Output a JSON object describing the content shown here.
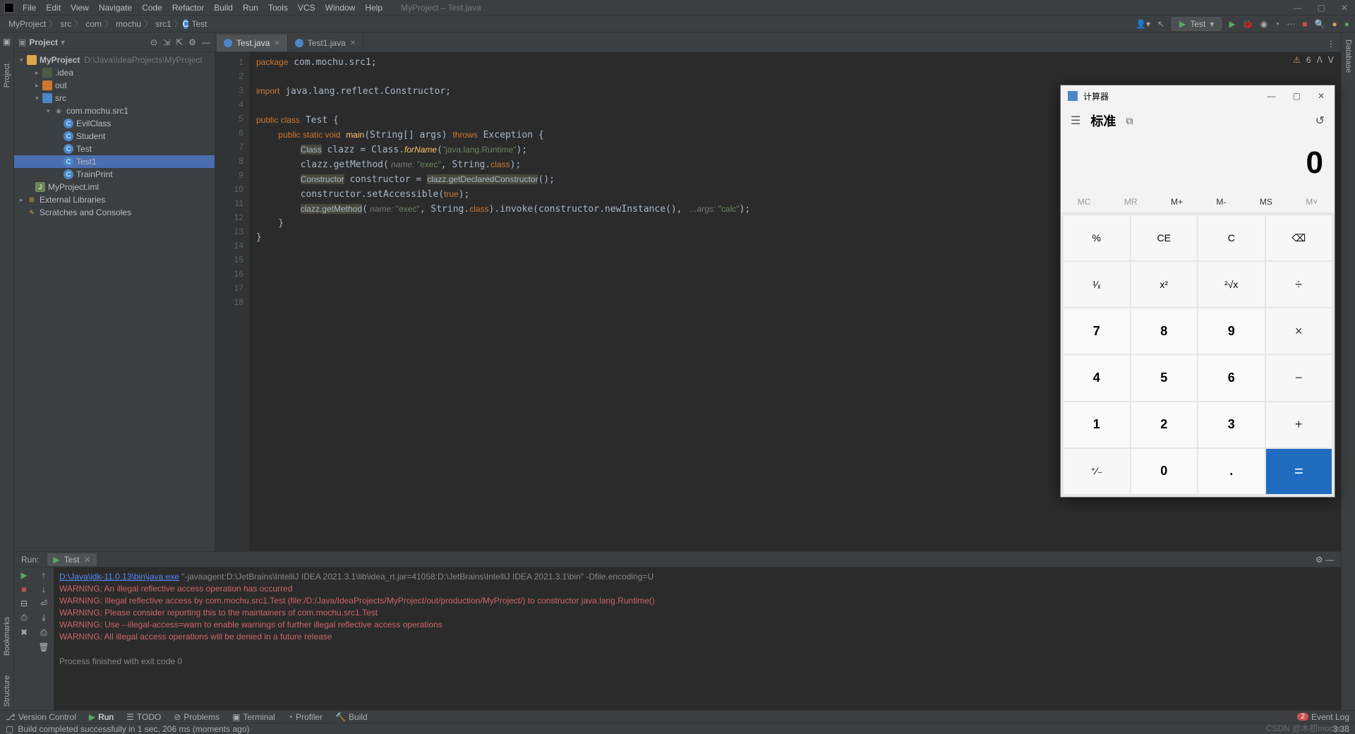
{
  "window": {
    "title": "MyProject – Test.java"
  },
  "menus": [
    "File",
    "Edit",
    "View",
    "Navigate",
    "Code",
    "Refactor",
    "Build",
    "Run",
    "Tools",
    "VCS",
    "Window",
    "Help"
  ],
  "breadcrumbs": [
    "MyProject",
    "src",
    "com",
    "mochu",
    "src1",
    "Test"
  ],
  "run_config": "Test",
  "warnings_count": "6",
  "project": {
    "title": "Project",
    "root": {
      "name": "MyProject",
      "path": "D:\\Java\\IdeaProjects\\MyProject"
    },
    "nodes": [
      {
        "name": ".idea",
        "depth": 2,
        "type": "folder"
      },
      {
        "name": "out",
        "depth": 2,
        "type": "folder-out"
      },
      {
        "name": "src",
        "depth": 2,
        "type": "folder-src",
        "open": true
      },
      {
        "name": "com.mochu.src1",
        "depth": 3,
        "type": "pkg",
        "open": true
      },
      {
        "name": "EvilClass",
        "depth": 4,
        "type": "class"
      },
      {
        "name": "Student",
        "depth": 4,
        "type": "class"
      },
      {
        "name": "Test",
        "depth": 4,
        "type": "class"
      },
      {
        "name": "Test1",
        "depth": 4,
        "type": "class",
        "sel": true
      },
      {
        "name": "TrainPrint",
        "depth": 4,
        "type": "class"
      },
      {
        "name": "MyProject.iml",
        "depth": 2,
        "type": "mod"
      }
    ],
    "ext_lib": "External Libraries",
    "scratches": "Scratches and Consoles"
  },
  "tabs": [
    {
      "label": "Test.java",
      "active": true
    },
    {
      "label": "Test1.java",
      "active": false
    }
  ],
  "code": {
    "lines": 18,
    "l1": "package com.mochu.src1;",
    "l3": "import java.lang.reflect.Constructor;",
    "l5": "public class Test {",
    "l6": "    public static void main(String[] args) throws Exception {",
    "l7a": "Class",
    "l7b": " clazz = Class.",
    "l7c": "forName",
    "l7d": "(",
    "l7e": "\"java.lang.Runtime\"",
    "l7f": ");",
    "l8a": "        clazz.getMethod(",
    "l8h": " name: ",
    "l8b": "\"exec\"",
    "l8c": ", String.",
    "l8d": "class",
    "l8e": ");",
    "l9a": "Constructor",
    "l9b": " constructor = ",
    "l9c": "clazz.getDeclaredConstructor",
    "l9d": "();",
    "l10": "        constructor.setAccessible(",
    "l10t": "true",
    "l10e": ");",
    "l11a": "clazz.getMethod",
    "l11b": "(",
    "l11h1": " name: ",
    "l11c": "\"exec\"",
    "l11d": ", String.",
    "l11e": "class",
    "l11f": ").invoke(constructor.newInstance(), ",
    "l11h2": " ...args: ",
    "l11g": "\"calc\"",
    "l11i": ");",
    "l12": "    }",
    "l13": "}"
  },
  "run": {
    "label": "Run:",
    "tab": "Test",
    "cmd": "D:\\Java\\jdk-11.0.13\\bin\\java.exe",
    "cmd_rest": " \"-javaagent:D:\\JetBrains\\IntelliJ IDEA 2021.3.1\\lib\\idea_rt.jar=41058:D:\\JetBrains\\IntelliJ IDEA 2021.3.1\\bin\" -Dfile.encoding=U",
    "w1": "WARNING: An illegal reflective access operation has occurred",
    "w2": "WARNING: Illegal reflective access by com.mochu.src1.Test (file:/D:/Java/IdeaProjects/MyProject/out/production/MyProject/) to constructor java.lang.Runtime()",
    "w3": "WARNING: Please consider reporting this to the maintainers of com.mochu.src1.Test",
    "w4": "WARNING: Use --illegal-access=warn to enable warnings of further illegal reflective access operations",
    "w5": "WARNING: All illegal access operations will be denied in a future release",
    "exit": "Process finished with exit code 0"
  },
  "bottom": {
    "vc": "Version Control",
    "run": "Run",
    "todo": "TODO",
    "problems": "Problems",
    "terminal": "Terminal",
    "profiler": "Profiler",
    "build": "Build",
    "event": "Event Log",
    "event_badge": "2"
  },
  "status": {
    "msg": "Build completed successfully in 1 sec, 206 ms (moments ago)",
    "pos": "3:38",
    "wm": "CSDN @木初mochu7"
  },
  "left_tools": [
    "Project",
    "Bookmarks",
    "Structure"
  ],
  "right_tools": [
    "Database"
  ],
  "calc": {
    "title": "计算器",
    "mode": "标准",
    "display": "0",
    "mem": [
      "MC",
      "MR",
      "M+",
      "M-",
      "MS",
      "M˅"
    ],
    "row1": [
      "%",
      "CE",
      "C",
      "⌫"
    ],
    "row2": [
      "¹⁄ₓ",
      "x²",
      "²√x",
      "÷"
    ],
    "row3": [
      "7",
      "8",
      "9",
      "×"
    ],
    "row4": [
      "4",
      "5",
      "6",
      "−"
    ],
    "row5": [
      "1",
      "2",
      "3",
      "+"
    ],
    "row6": [
      "⁺⁄₋",
      "0",
      ".",
      "="
    ]
  }
}
